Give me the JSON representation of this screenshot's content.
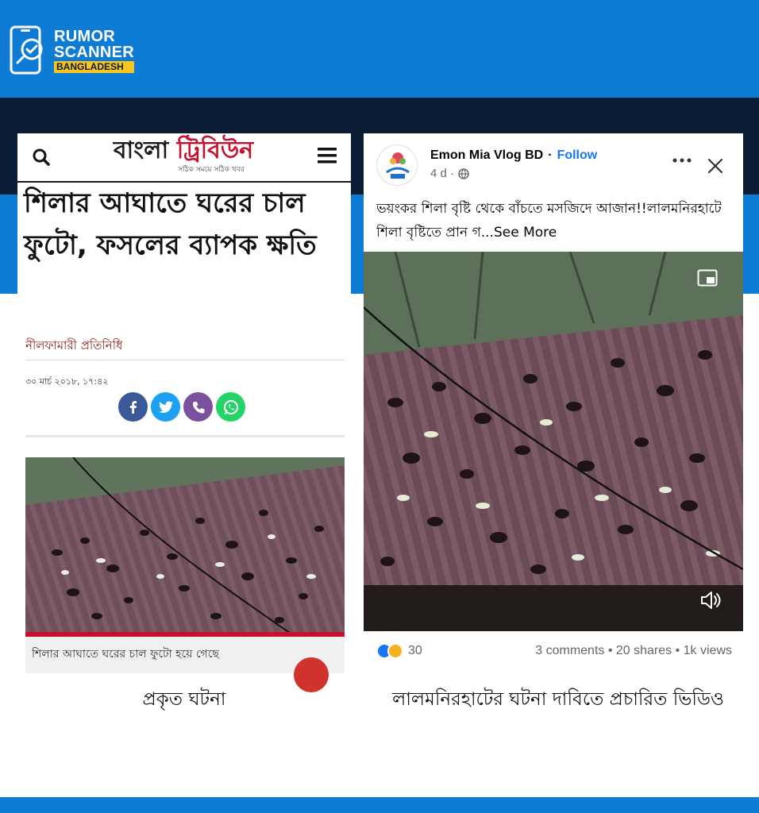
{
  "brand": {
    "line1": "RUMOR",
    "line2": "SCANNER",
    "badge": "BANGLADESH"
  },
  "left_card": {
    "site_name_part1": "বাংলা",
    "site_name_part2": "ট্রিবিউন",
    "site_tagline": "সঠিক সময়ে সঠিক খবর",
    "headline": "শিলার আঘাতে ঘরের চাল ফুটো, ফসলের ব্যাপক ক্ষতি",
    "reporter": "নীলফামারী প্রতিনিধি",
    "date": "৩০ মার্চ ২০১৮, ১৭:৪২",
    "share_buttons": [
      "facebook-icon",
      "twitter-icon",
      "viber-icon",
      "whatsapp-icon"
    ],
    "image_caption": "শিলার আঘাতে ঘরের চাল ফুটো হয়ে গেছে",
    "colors": {
      "accent_red": "#c8102e",
      "reporter": "#8b1a1a"
    }
  },
  "right_card": {
    "page_name": "Emon Mia Vlog BD",
    "separator": "·",
    "follow_label": "Follow",
    "time": "4 d ·",
    "post_text": "ভয়ংকর শিলা বৃষ্টি থেকে বাঁচতে মসজিদে আজান!!লালমনিরহাটে শিলা বৃষ্টিতে প্রান গ...",
    "see_more": "See More",
    "reaction_count": "30",
    "stats": "3 comments • 20 shares • 1k views",
    "colors": {
      "facebook_blue": "#1877f2",
      "meta_gray": "#65676b"
    }
  },
  "labels": {
    "left": "প্রকৃত ঘটনা",
    "right": "লালমনিরহাটের ঘটনা দাবিতে প্রচারিত ভিডিও"
  },
  "theme": {
    "brand_blue": "#0e7bd4",
    "dark_navy": "#0b1d35",
    "badge_yellow": "#f8c51c"
  }
}
